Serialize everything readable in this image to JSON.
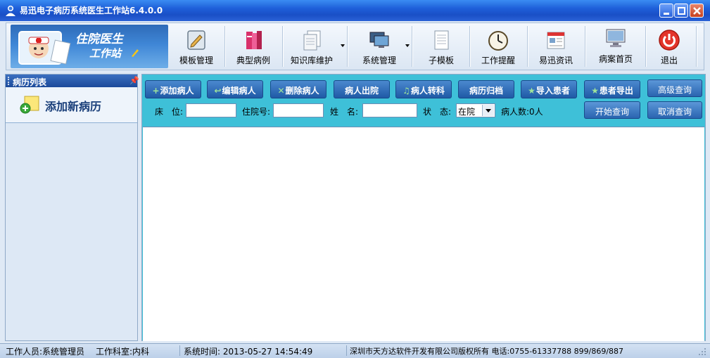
{
  "window": {
    "title": "易迅电子病历系统医生工作站6.4.0.0"
  },
  "banner": {
    "line1": "住院医生",
    "line2": "工作站"
  },
  "toolbar": {
    "template_manage": "模板管理",
    "typical_cases": "典型病例",
    "knowledge_base": "知识库维护",
    "system_manage": "系统管理",
    "sub_template": "子模板",
    "work_reminder": "工作提醒",
    "news": "易迅资讯",
    "home": "病案首页",
    "exit": "退出"
  },
  "left_panel": {
    "header": "病历列表",
    "add_new": "添加新病历"
  },
  "actions": {
    "add_patient": "添加病人",
    "edit_patient": "编辑病人",
    "delete_patient": "删除病人",
    "discharge": "病人出院",
    "transfer": "病人转科",
    "archive": "病历归档",
    "import_patient": "导入患者",
    "export_patient": "患者导出",
    "advanced_query": "高级查询",
    "start_query": "开始查询",
    "cancel_query": "取消查询"
  },
  "filters": {
    "bed_label": "床　位:",
    "admission_label": "住院号:",
    "name_label": "姓　名:",
    "status_label": "状　态:",
    "status_value": "在院",
    "patient_count": "病人数:0人"
  },
  "status_bar": {
    "staff": "工作人员:系统管理员",
    "department": "工作科室:内科",
    "system_time": "系统时间: 2013-05-27 14:54:49",
    "copyright": "深圳市天方达软件开发有限公司版权所有 电话:0755-61337788  899/869/887"
  }
}
